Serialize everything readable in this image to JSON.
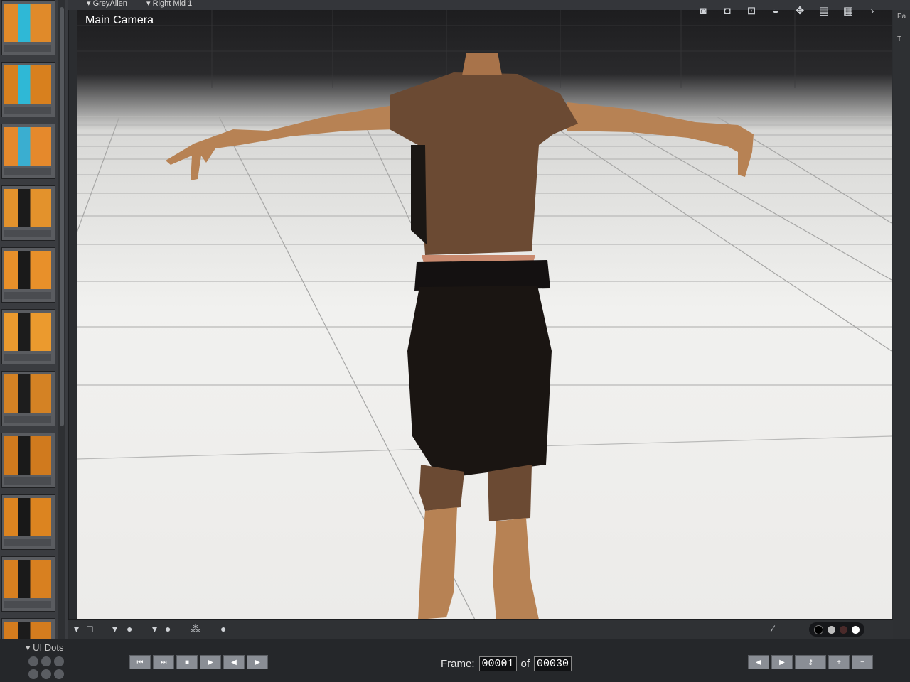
{
  "top_bar": {
    "crumb_1": "GreyAlien",
    "crumb_2": "Right Mid 1"
  },
  "viewport": {
    "camera_label": "Main Camera"
  },
  "right_edge": {
    "label_1": "Pa",
    "label_2": "T"
  },
  "thumbnails": [
    {
      "bg": "#e08a2a",
      "accent": "#2fb8d6"
    },
    {
      "bg": "#d8801e",
      "accent": "#2fb8d6"
    },
    {
      "bg": "#e5892c",
      "accent": "#3aaed0"
    },
    {
      "bg": "#e3922c",
      "accent": "#1b1b1b"
    },
    {
      "bg": "#e8902a",
      "accent": "#1a1a1a"
    },
    {
      "bg": "#eb9a2e",
      "accent": "#1c1c1c"
    },
    {
      "bg": "#d48224",
      "accent": "#1d1d1d"
    },
    {
      "bg": "#d07a1e",
      "accent": "#1a1a1a"
    },
    {
      "bg": "#dc8420",
      "accent": "#181818"
    },
    {
      "bg": "#d88020",
      "accent": "#1a1a1a"
    },
    {
      "bg": "#d47c1e",
      "accent": "#1c1c1c"
    }
  ],
  "bottom_panel": {
    "ui_dots_label": "UI Dots",
    "frame_label": "Frame:",
    "frame_current": "00001",
    "frame_of": "of",
    "frame_total": "00030"
  },
  "colors": {
    "skin": "#b78254",
    "shirt": "#6b4a33",
    "apron": "#1a1512",
    "belt": "#c98a6f"
  }
}
